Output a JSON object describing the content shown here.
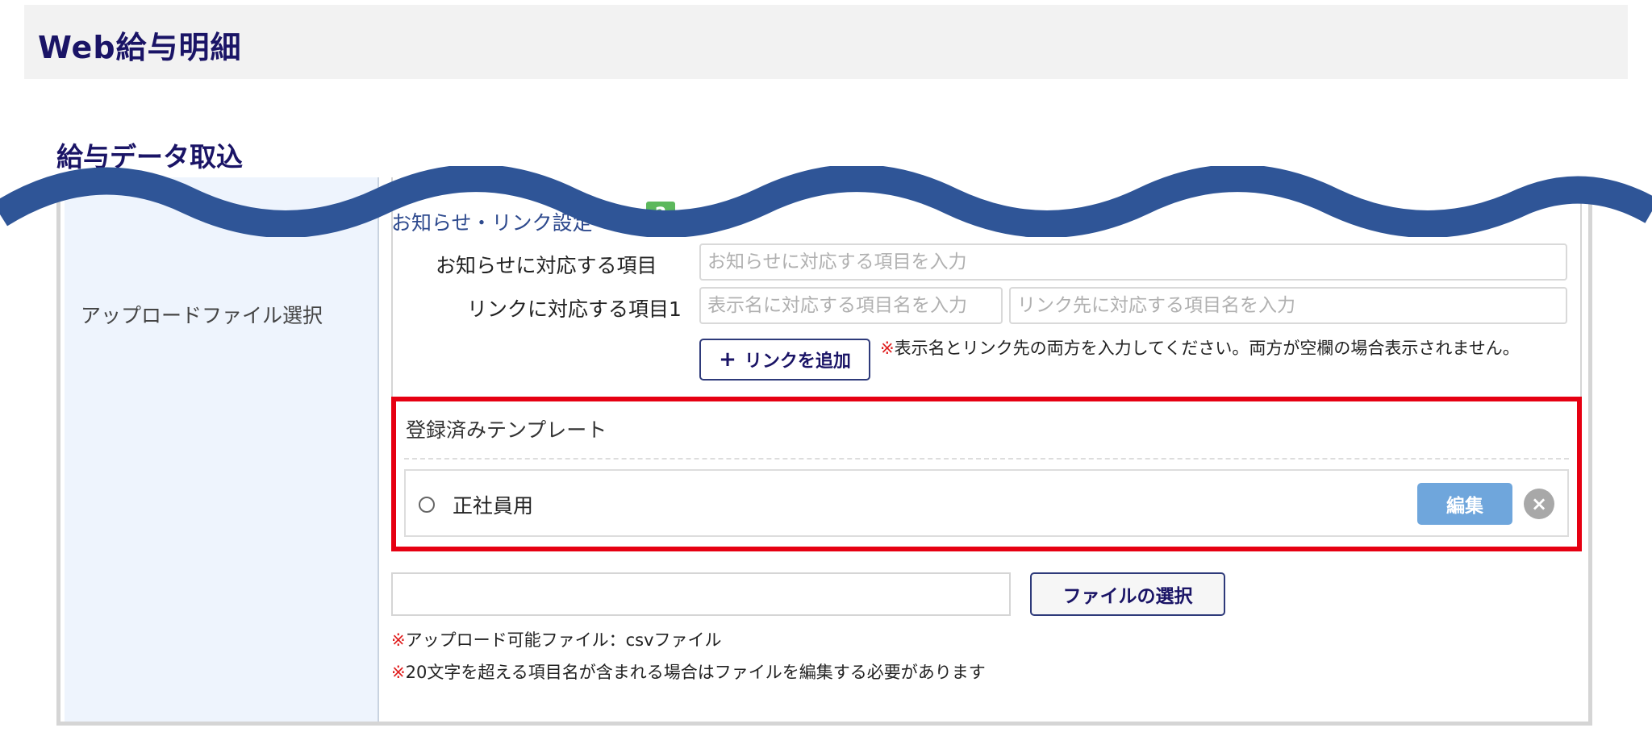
{
  "header": {
    "title": "Web給与明細"
  },
  "section": {
    "title": "給与データ取込"
  },
  "form": {
    "upload_label": "アップロードファイル選択",
    "settings_title": "お知らせ・リンク設定",
    "help_icon": "?",
    "notice": {
      "label": "お知らせに対応する項目",
      "placeholder": "お知らせに対応する項目を入力"
    },
    "link1": {
      "label": "リンクに対応する項目1",
      "display_placeholder": "表示名に対応する項目名を入力",
      "target_placeholder": "リンク先に対応する項目名を入力"
    },
    "add_link": {
      "plus": "+",
      "label": "リンクを追加"
    },
    "link_note": {
      "mark": "※",
      "text": "表示名とリンク先の両方を入力してください。両方が空欄の場合表示されません。"
    }
  },
  "templates": {
    "title": "登録済みテンプレート",
    "items": [
      {
        "name": "正社員用",
        "edit_label": "編集",
        "delete_symbol": "×"
      }
    ]
  },
  "file": {
    "path_value": "",
    "select_label": "ファイルの選択",
    "notes": [
      {
        "mark": "※",
        "text": "アップロード可能ファイル：csvファイル"
      },
      {
        "mark": "※",
        "text": "20文字を超える項目名が含まれる場合はファイルを編集する必要があります"
      }
    ]
  },
  "colors": {
    "brand_navy": "#1a1466",
    "highlight_red": "#e60012",
    "edit_blue": "#6fa6dc",
    "help_green": "#5cb85c",
    "wave_blue": "#2f5597"
  },
  "icons": {
    "help": "question-icon",
    "add": "plus-icon",
    "delete": "close-icon",
    "radio": "radio-button"
  }
}
